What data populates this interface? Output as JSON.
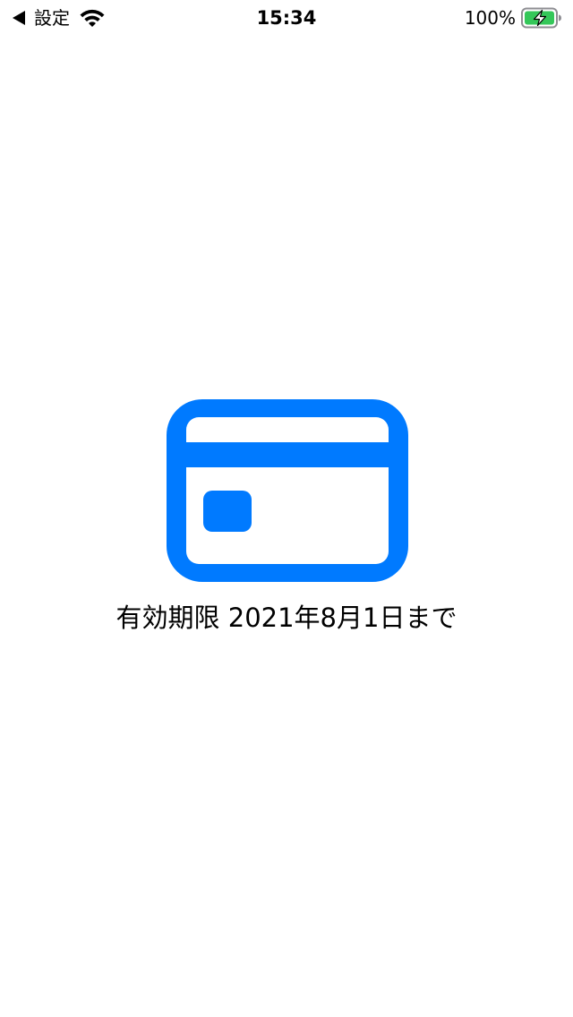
{
  "status_bar": {
    "back_label": "設定",
    "time": "15:34",
    "battery_percent": "100%"
  },
  "main": {
    "icon": "credit-card-icon",
    "expiry_text": "有効期限 2021年8月1日まで"
  },
  "colors": {
    "accent": "#007AFF",
    "battery_fill": "#34C759",
    "text": "#000000",
    "background": "#FFFFFF"
  }
}
